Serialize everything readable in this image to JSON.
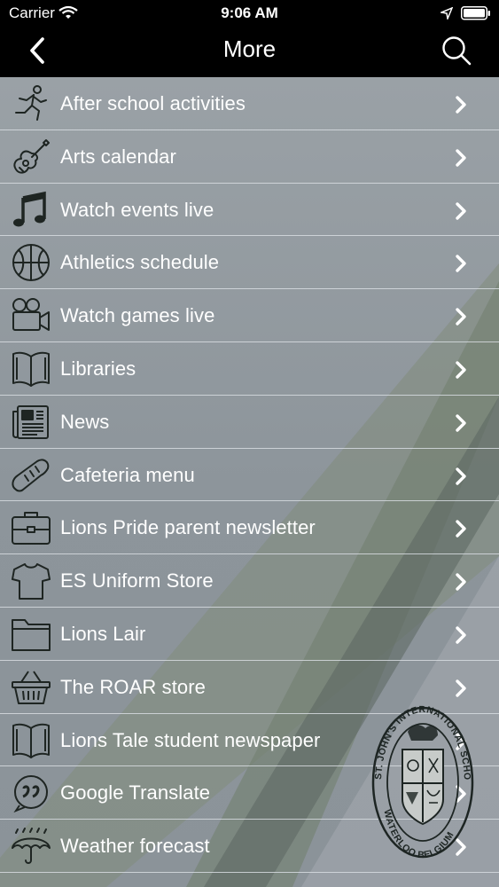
{
  "status_bar": {
    "carrier": "Carrier",
    "time": "9:06 AM"
  },
  "nav": {
    "title": "More",
    "back_icon": "chevron-left-icon",
    "search_icon": "search-icon"
  },
  "items": [
    {
      "label": "After school activities",
      "icon": "running-person-icon"
    },
    {
      "label": "Arts calendar",
      "icon": "guitar-icon"
    },
    {
      "label": "Watch events live",
      "icon": "music-note-icon"
    },
    {
      "label": "Athletics schedule",
      "icon": "basketball-icon"
    },
    {
      "label": "Watch games live",
      "icon": "video-camera-icon"
    },
    {
      "label": "Libraries",
      "icon": "open-book-icon"
    },
    {
      "label": "News",
      "icon": "newspaper-icon"
    },
    {
      "label": "Cafeteria menu",
      "icon": "bread-icon"
    },
    {
      "label": "Lions Pride parent newsletter",
      "icon": "briefcase-icon"
    },
    {
      "label": "ES Uniform Store",
      "icon": "tshirt-icon"
    },
    {
      "label": "Lions Lair",
      "icon": "folder-icon"
    },
    {
      "label": "The ROAR store",
      "icon": "shopping-basket-icon"
    },
    {
      "label": "Lions Tale student newspaper",
      "icon": "open-book-icon"
    },
    {
      "label": "Google Translate",
      "icon": "quote-bubble-icon"
    },
    {
      "label": "Weather forecast",
      "icon": "umbrella-icon"
    }
  ],
  "crest": {
    "text_top": "ST. JOHN'S INTERNATIONAL SCHOOL",
    "text_bottom": "WATERLOO BELGIUM"
  },
  "colors": {
    "nav_bg": "#000000",
    "list_bg": "#8e959b",
    "accent_green": "#8a9878",
    "text": "#ffffff",
    "icon_stroke": "#1e2522"
  }
}
